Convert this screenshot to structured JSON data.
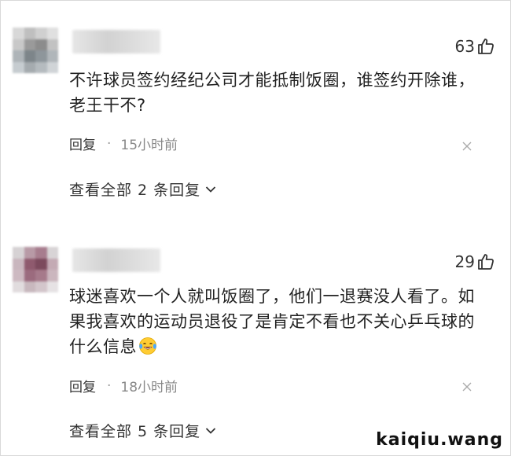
{
  "comments": [
    {
      "likes": "63",
      "text": "不许球员签约经纪公司才能抵制饭圈，谁签约开除谁，老王干不?",
      "reply_label": "回复",
      "time": "15小时前",
      "replies_label": "查看全部 2 条回复"
    },
    {
      "likes": "29",
      "text": "球迷喜欢一个人就叫饭圈了，他们一退赛没人看了。如果我喜欢的运动员退役了是肯定不看也不关心乒乓球的什么信息",
      "reply_label": "回复",
      "time": "18小时前",
      "replies_label": "查看全部 5 条回复"
    }
  ],
  "watermark": "kaiqiu.wang",
  "icons": {
    "like": "thumbs-up-icon",
    "close": "close-icon",
    "expand": "chevron-down-icon",
    "emoji": "laughing-crying-emoji-icon"
  },
  "colors": {
    "text": "#222222",
    "meta": "#888888",
    "background": "#ffffff"
  }
}
